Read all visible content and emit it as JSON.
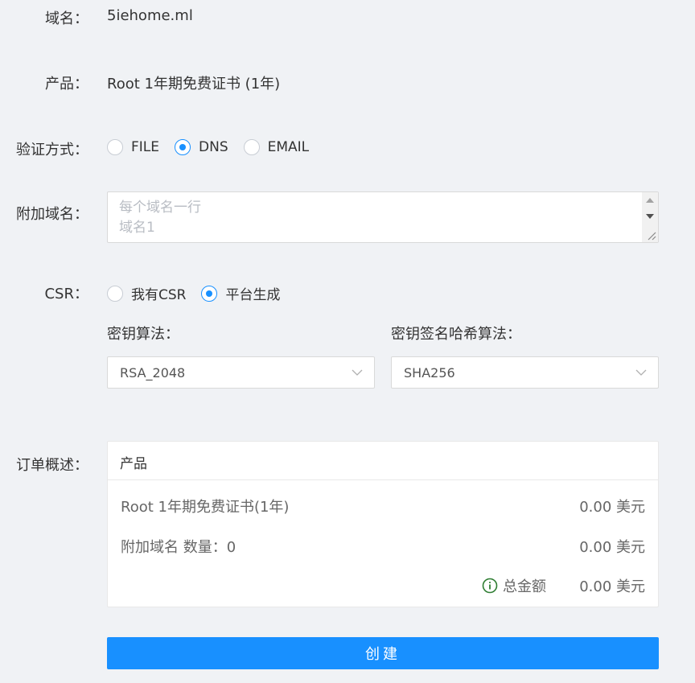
{
  "domain": {
    "label": "域名：",
    "value": "5iehome.ml"
  },
  "product": {
    "label": "产品：",
    "value": "Root 1年期免费证书 (1年)"
  },
  "verification": {
    "label": "验证方式：",
    "options": [
      {
        "label": "FILE",
        "checked": false
      },
      {
        "label": "DNS",
        "checked": true
      },
      {
        "label": "EMAIL",
        "checked": false
      }
    ]
  },
  "extra_domains": {
    "label": "附加域名：",
    "placeholder": "每个域名一行\n域名1"
  },
  "csr": {
    "label": "CSR：",
    "options": [
      {
        "label": "我有CSR",
        "checked": false
      },
      {
        "label": "平台生成",
        "checked": true
      }
    ],
    "key_algo_label": "密钥算法：",
    "key_algo_value": "RSA_2048",
    "hash_algo_label": "密钥签名哈希算法：",
    "hash_algo_value": "SHA256"
  },
  "order": {
    "label": "订单概述：",
    "header": "产品",
    "lines": [
      {
        "label": "Root 1年期免费证书(1年)",
        "amount": "0.00 美元"
      },
      {
        "label": "附加域名 数量：0",
        "amount": "0.00 美元"
      }
    ],
    "total_label": "总金额",
    "total_amount": "0.00 美元"
  },
  "create_button": "创建",
  "colors": {
    "primary": "#1890ff",
    "background": "#f0f2f5",
    "info_icon": "#2e7d32"
  }
}
